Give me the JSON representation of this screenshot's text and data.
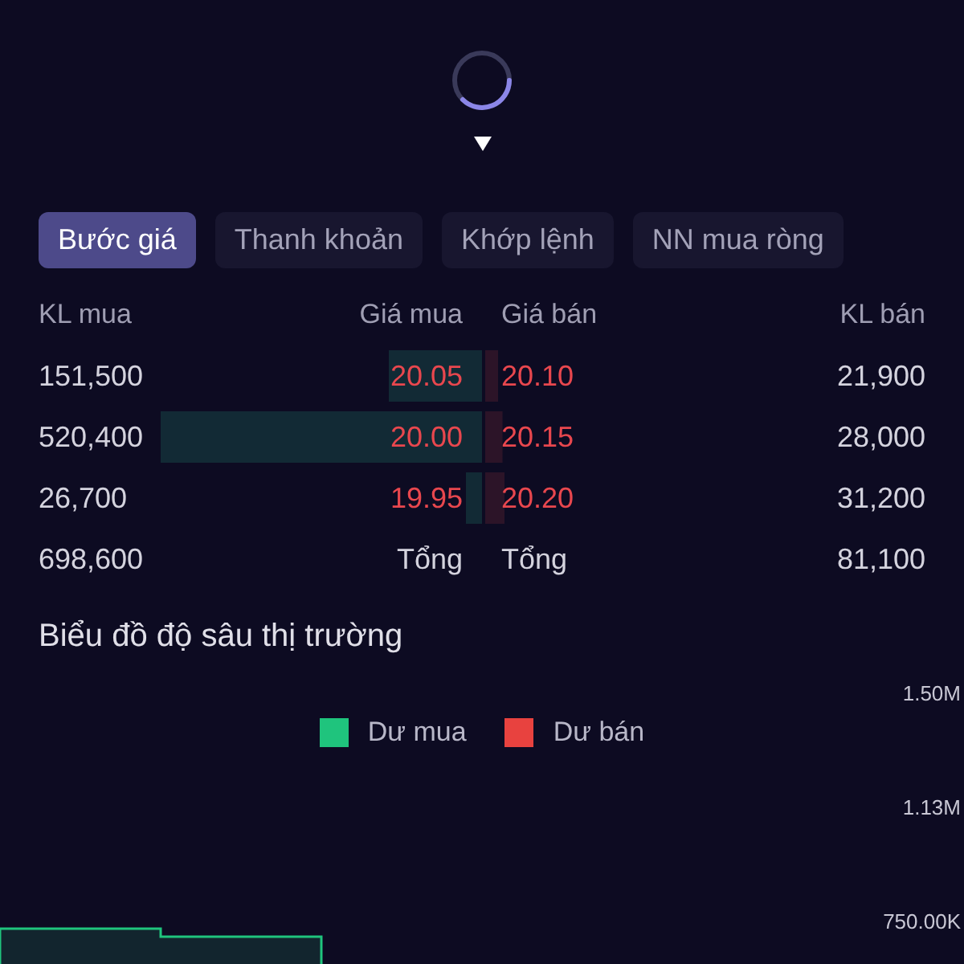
{
  "tabs": [
    {
      "label": "Bước giá",
      "selected": true
    },
    {
      "label": "Thanh khoản",
      "selected": false
    },
    {
      "label": "Khớp lệnh",
      "selected": false
    },
    {
      "label": "NN mua ròng",
      "selected": false
    }
  ],
  "order_book": {
    "columns": [
      "KL mua",
      "Giá mua",
      "Giá bán",
      "KL bán"
    ],
    "rows": [
      {
        "bid_volume": "151,500",
        "bid_price": "20.05",
        "ask_price": "20.10",
        "ask_volume": "21,900"
      },
      {
        "bid_volume": "520,400",
        "bid_price": "20.00",
        "ask_price": "20.15",
        "ask_volume": "28,000"
      },
      {
        "bid_volume": "26,700",
        "bid_price": "19.95",
        "ask_price": "20.20",
        "ask_volume": "31,200"
      }
    ],
    "totals": {
      "bid_volume": "698,600",
      "bid_label": "Tổng",
      "ask_label": "Tổng",
      "ask_volume": "81,100"
    }
  },
  "depth_chart": {
    "title": "Biểu đồ độ sâu thị trường",
    "legend": [
      {
        "label": "Dư mua",
        "color": "#1fc47d"
      },
      {
        "label": "Dư bán",
        "color": "#e8423f"
      }
    ],
    "axis_labels": [
      "1.50M",
      "1.13M",
      "750.00K"
    ]
  }
}
